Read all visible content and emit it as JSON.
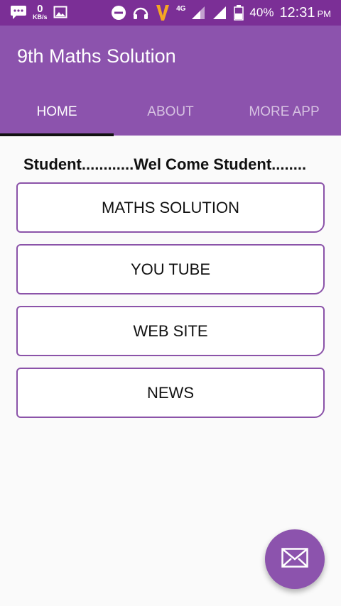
{
  "status_bar": {
    "speed_value": "0",
    "speed_unit": "KB/s",
    "network": "4G",
    "battery": "40%",
    "time": "12:31",
    "ampm": "PM",
    "icons": [
      "chat-icon",
      "image-icon",
      "dnd-icon",
      "headset-icon",
      "carrier-v-icon",
      "signal-icon",
      "battery-icon"
    ]
  },
  "app_bar": {
    "title": "9th Maths Solution",
    "color": "#8c53ad",
    "status_color": "#7b2f96"
  },
  "tabs": [
    {
      "label": "HOME",
      "active": true
    },
    {
      "label": "ABOUT",
      "active": false
    },
    {
      "label": "MORE APP",
      "active": false
    }
  ],
  "marquee": {
    "text": "Student............Wel Come Student........"
  },
  "menu": [
    {
      "label": "MATHS SOLUTION"
    },
    {
      "label": "YOU TUBE"
    },
    {
      "label": "WEB SITE"
    },
    {
      "label": "NEWS"
    }
  ],
  "fab": {
    "icon": "mail-icon"
  }
}
